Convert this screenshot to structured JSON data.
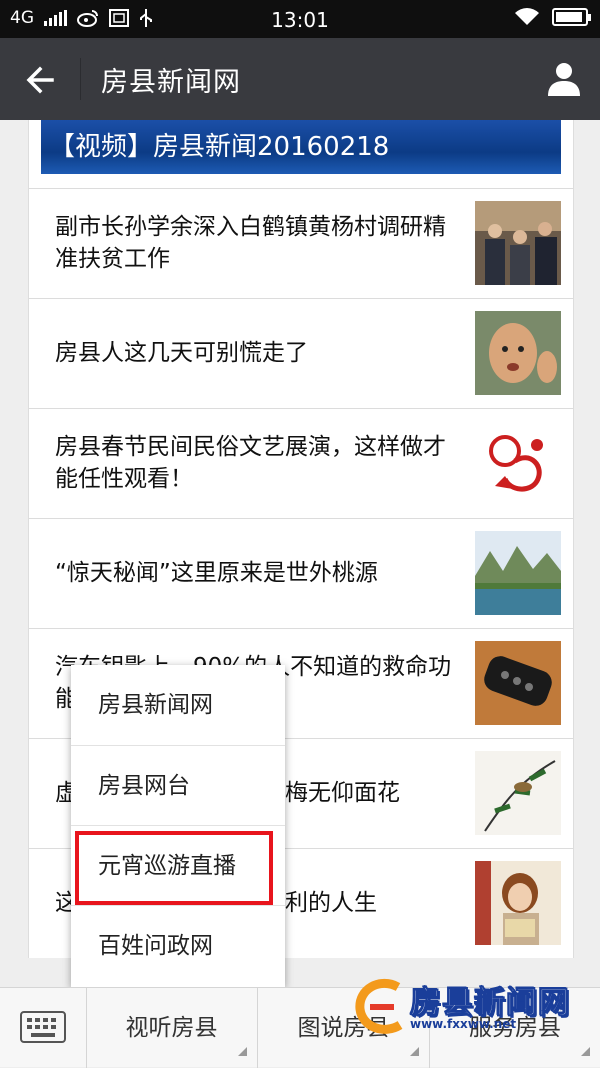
{
  "status_bar": {
    "network": "4G",
    "time": "13:01"
  },
  "header": {
    "title": "房县新闻网"
  },
  "banner": {
    "text": "【视频】房县新闻20160218"
  },
  "articles": [
    {
      "title": "副市长孙学余深入白鹤镇黄杨村调研精准扶贫工作"
    },
    {
      "title": "房县人这几天可别慌走了"
    },
    {
      "title": "房县春节民间民俗文艺展演，这样做才能任性观看！"
    },
    {
      "title": "“惊天秘闻”这里原来是世外桃源"
    },
    {
      "title": "汽车钥匙上，90%的人不知道的救命功能"
    },
    {
      "title": "虚心竹有低头叶，傲骨梅无仰面花"
    },
    {
      "title": "这几种人，在社会里顺利的人生"
    }
  ],
  "popup_menu": {
    "items": [
      "房县新闻网",
      "房县网台",
      "元宵巡游直播",
      "百姓问政网"
    ],
    "highlighted_index": 2
  },
  "bottom_tabs": [
    "视听房县",
    "图说房县",
    "服务房县"
  ],
  "watermark": {
    "text": "房县新闻网",
    "url": "www.fxxww.net"
  },
  "colors": {
    "nav_bg": "#393a3f",
    "status_bg": "#0f0f0f",
    "highlight_border": "#e8141c",
    "banner_bg": "#0c3b85"
  }
}
